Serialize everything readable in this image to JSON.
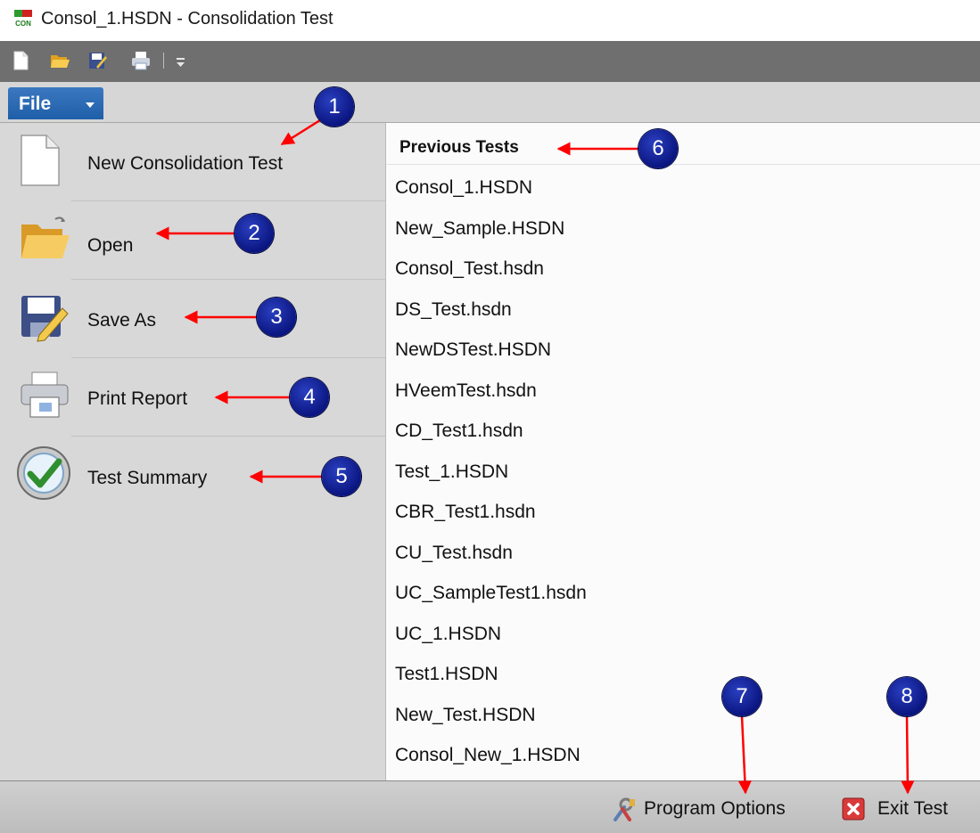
{
  "window": {
    "title": "Consol_1.HSDN - Consolidation Test",
    "app_icon_text": "CON"
  },
  "quick_access": {
    "icons": [
      "new-document-icon",
      "open-folder-icon",
      "save-as-icon",
      "print-icon",
      "customize-toolbar-icon"
    ]
  },
  "file_tab": {
    "label": "File"
  },
  "menu": {
    "items": [
      {
        "label": "New Consolidation Test",
        "icon": "new-document-icon"
      },
      {
        "label": "Open",
        "icon": "open-folder-icon"
      },
      {
        "label": "Save As",
        "icon": "save-as-icon"
      },
      {
        "label": "Print Report",
        "icon": "print-icon"
      },
      {
        "label": "Test Summary",
        "icon": "test-summary-icon"
      }
    ]
  },
  "recent": {
    "header": "Previous Tests",
    "files": [
      "Consol_1.HSDN",
      "New_Sample.HSDN",
      "Consol_Test.hsdn",
      "DS_Test.hsdn",
      "NewDSTest.HSDN",
      "HVeemTest.hsdn",
      "CD_Test1.hsdn",
      "Test_1.HSDN",
      "CBR_Test1.hsdn",
      "CU_Test.hsdn",
      "UC_SampleTest1.hsdn",
      "UC_1.HSDN",
      "Test1.HSDN",
      "New_Test.HSDN",
      "Consol_New_1.HSDN"
    ]
  },
  "statusbar": {
    "options_label": "Program Options",
    "exit_label": "Exit Test"
  },
  "annotations": {
    "badges": [
      "1",
      "2",
      "3",
      "4",
      "5",
      "6",
      "7",
      "8"
    ],
    "arrow_color": "#ff0000",
    "badge_color": "#0a1580"
  }
}
